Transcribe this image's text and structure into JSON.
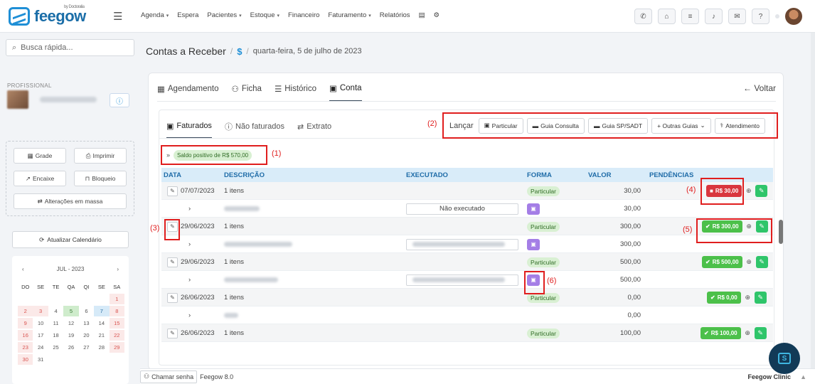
{
  "brand": {
    "name": "feegow",
    "sub": "by Doctoralia"
  },
  "topnav": {
    "items": [
      {
        "label": "Agenda",
        "dropdown": true
      },
      {
        "label": "Espera",
        "dropdown": false
      },
      {
        "label": "Pacientes",
        "dropdown": true
      },
      {
        "label": "Estoque",
        "dropdown": true
      },
      {
        "label": "Financeiro",
        "dropdown": false
      },
      {
        "label": "Faturamento",
        "dropdown": true
      },
      {
        "label": "Relatórios",
        "dropdown": false
      }
    ]
  },
  "topicons": [
    "phone-icon",
    "inbox-icon",
    "list-icon",
    "bell-icon",
    "chat-icon",
    "help-icon"
  ],
  "sidebar": {
    "search_placeholder": "Busca rápida...",
    "profissional_label": "PROFISSIONAL",
    "buttons": {
      "grade": "Grade",
      "imprimir": "Imprimir",
      "encaixe": "Encaixe",
      "bloqueio": "Bloqueio",
      "alteracoes": "Alterações em massa",
      "atualizar": "Atualizar Calendário"
    },
    "calendar": {
      "month": "JUL - 2023",
      "weekdays": [
        "DO",
        "SE",
        "TE",
        "QA",
        "QI",
        "SE",
        "SA"
      ],
      "days": [
        "",
        "",
        "",
        "",
        "",
        "",
        "1",
        "2",
        "3",
        "4",
        "5",
        "6",
        "7",
        "8",
        "9",
        "10",
        "11",
        "12",
        "13",
        "14",
        "15",
        "16",
        "17",
        "18",
        "19",
        "20",
        "21",
        "22",
        "23",
        "24",
        "25",
        "26",
        "27",
        "28",
        "29",
        "30",
        "31"
      ]
    }
  },
  "breadcrumb": {
    "title": "Contas a Receber",
    "icon": "$",
    "date": "quarta-feira, 5 de julho de 2023"
  },
  "tabs": {
    "agendamento": "Agendamento",
    "ficha": "Ficha",
    "historico": "Histórico",
    "conta": "Conta",
    "voltar": "Voltar"
  },
  "subtabs": {
    "faturados": "Faturados",
    "nao_faturados": "Não faturados",
    "extrato": "Extrato"
  },
  "lancar": {
    "label": "Lançar",
    "particular": "Particular",
    "guia_consulta": "Guia Consulta",
    "guia_sp": "Guia SP/SADT",
    "outras": "+ Outras Guias",
    "atendimento": "Atendimento"
  },
  "annotations": {
    "a1": "(1)",
    "a2": "(2)",
    "a3": "(3)",
    "a4": "(4)",
    "a5": "(5)",
    "a6": "(6)"
  },
  "saldo": "Saldo positivo de R$ 570,00",
  "table": {
    "headers": {
      "data": "DATA",
      "descricao": "DESCRIÇÃO",
      "executado": "EXECUTADO",
      "forma": "FORMA",
      "valor": "VALOR",
      "pendencias": "PENDÊNCIAS"
    },
    "rows": [
      {
        "date": "07/07/2023",
        "desc": "1 itens",
        "forma": "Particular",
        "valor": "30,00",
        "pend": "R$ 30,00",
        "sub_exec": "Não executado",
        "sub_valor": "30,00"
      },
      {
        "date": "29/06/2023",
        "desc": "1 itens",
        "forma": "Particular",
        "valor": "300,00",
        "pend": "R$ 300,00",
        "sub_valor": "300,00"
      },
      {
        "date": "29/06/2023",
        "desc": "1 itens",
        "forma": "Particular",
        "valor": "500,00",
        "pend": "R$ 500,00",
        "sub_valor": "500,00"
      },
      {
        "date": "26/06/2023",
        "desc": "1 itens",
        "forma": "Particular",
        "valor": "0,00",
        "pend": "R$ 0,00",
        "sub_valor": "0,00"
      },
      {
        "date": "26/06/2023",
        "desc": "1 itens",
        "forma": "Particular",
        "valor": "100,00",
        "pend": "R$ 100,00"
      }
    ]
  },
  "footer": {
    "chamar": "Chamar senha",
    "version": "Feegow 8.0",
    "clinic": "Feegow Clinic"
  },
  "colors": {
    "accent": "#1f8fd6",
    "red": "#d9363e",
    "green": "#4cc04a",
    "purple": "#a47ee6",
    "annotation": "#e01e1e"
  }
}
